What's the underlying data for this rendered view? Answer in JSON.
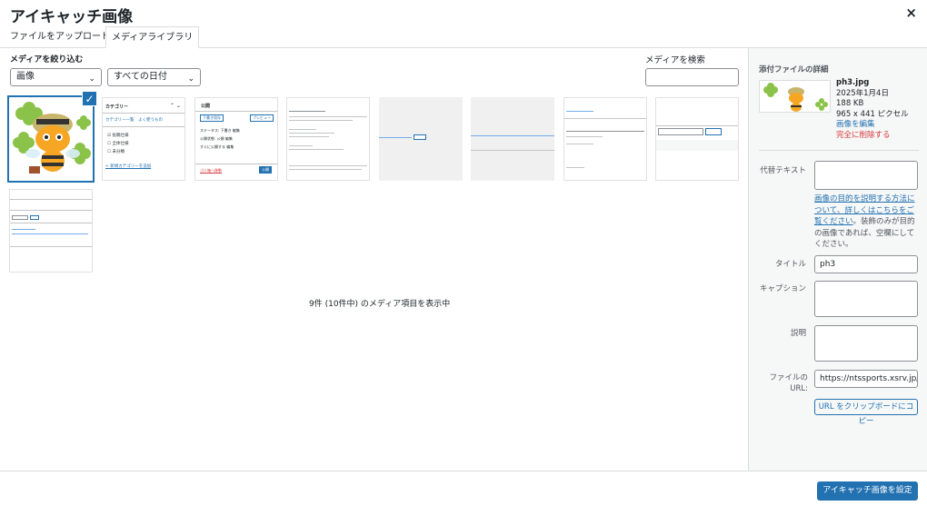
{
  "modal": {
    "title": "アイキャッチ画像",
    "close_label": "×"
  },
  "tabs": [
    {
      "label": "ファイルをアップロード",
      "active": false
    },
    {
      "label": "メディアライブラリ",
      "active": true
    }
  ],
  "filters": {
    "label": "メディアを絞り込む",
    "type_selected": "画像",
    "date_selected": "すべての日付"
  },
  "search": {
    "label": "メディアを検索",
    "value": ""
  },
  "media_count_text": "9件 (10件中) のメディア項目を表示中",
  "thumb_texts": {
    "category_title": "カテゴリー",
    "category_tabs": "カテゴリー一覧　よく使うもの",
    "cat_items": [
      "投稿仕様",
      "全体仕様",
      "未分類"
    ],
    "add_category": "+ 新規カテゴリーを追加",
    "publish_title": "公開",
    "save_draft": "下書き保存",
    "preview": "プレビュー",
    "status": "ステータス: 下書き 編集",
    "visibility": "公開状態: 公開 編集",
    "schedule": "すぐに公開する 編集",
    "trash": "ゴミ箱へ移動",
    "publish_btn": "公開"
  },
  "attachment": {
    "section_title": "添付ファイルの詳細",
    "filename": "ph3.jpg",
    "date": "2025年1月4日",
    "size": "188 KB",
    "dimensions": "965 x 441 ピクセル",
    "edit_link": "画像を編集",
    "delete_link": "完全に削除する",
    "alt_label": "代替テキスト",
    "alt_value": "",
    "alt_help_link": "画像の目的を説明する方法について、詳しくはこちらをご覧ください",
    "alt_help_text": "。装飾のみが目的の画像であれば、空欄にしてください。",
    "title_label": "タイトル",
    "title_value": "ph3",
    "caption_label": "キャプション",
    "caption_value": "",
    "description_label": "説明",
    "description_value": "",
    "url_label": "ファイルの URL:",
    "url_value": "https://ntssports.xsrv.jp/m",
    "copy_button": "URL をクリップボードにコピー"
  },
  "footer": {
    "primary_button": "アイキャッチ画像を設定"
  },
  "colors": {
    "accent": "#2271b1",
    "danger": "#d63638",
    "sidebar_bg": "#f6f7f7"
  }
}
